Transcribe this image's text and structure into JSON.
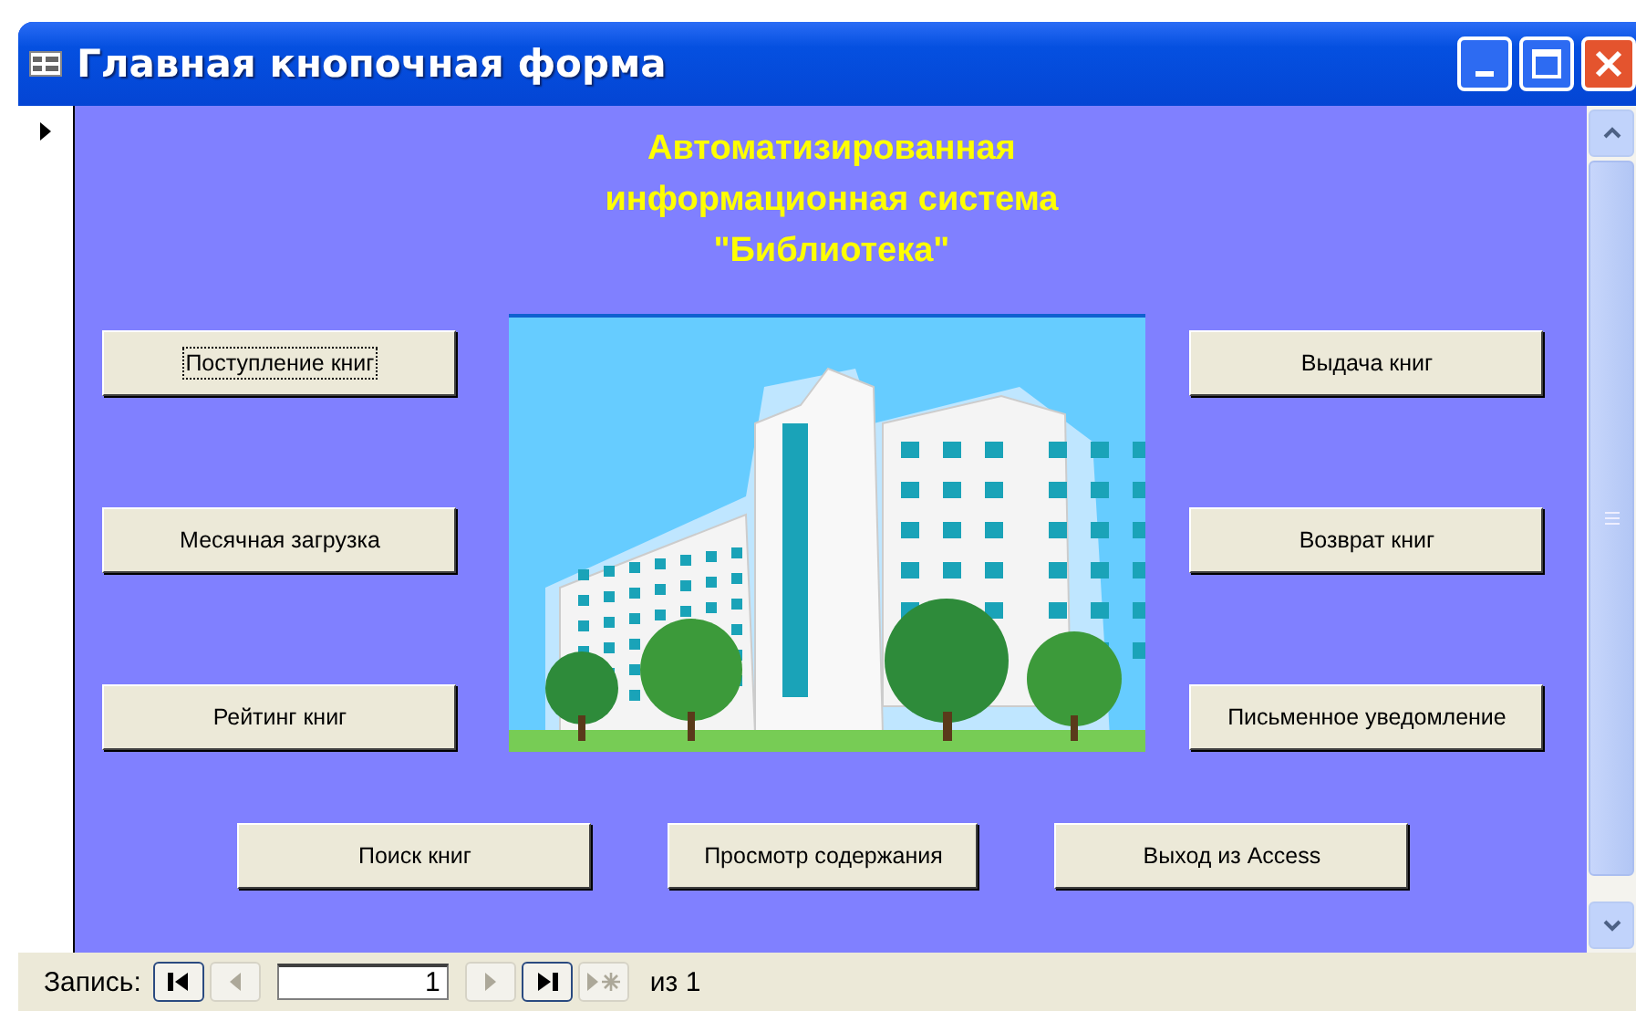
{
  "window": {
    "title": "Главная кнопочная форма"
  },
  "form": {
    "title_lines": [
      "Автоматизированная",
      "информационная система",
      "\"Библиотека\""
    ],
    "left_buttons": [
      {
        "label": "Поступление книг",
        "focused": true
      },
      {
        "label": "Месячная загрузка",
        "focused": false
      },
      {
        "label": "Рейтинг книг",
        "focused": false
      }
    ],
    "right_buttons": [
      {
        "label": "Выдача книг",
        "focused": false
      },
      {
        "label": "Возврат книг",
        "focused": false
      },
      {
        "label": "Письменное уведомление",
        "focused": false
      }
    ],
    "bottom_buttons": [
      {
        "label": "Поиск книг",
        "focused": false
      },
      {
        "label": "Просмотр содержания",
        "focused": false
      },
      {
        "label": "Выход из Access",
        "focused": false
      }
    ]
  },
  "navigation": {
    "label": "Запись:",
    "record": "1",
    "total": "из 1",
    "buttons": [
      {
        "kind": "first",
        "disabled": false
      },
      {
        "kind": "prev",
        "disabled": true
      },
      {
        "kind": "next",
        "disabled": true
      },
      {
        "kind": "last",
        "disabled": false
      },
      {
        "kind": "new",
        "disabled": true
      }
    ]
  }
}
